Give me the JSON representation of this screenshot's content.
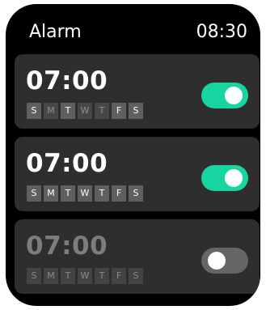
{
  "header": {
    "title": "Alarm",
    "clock": "08:30"
  },
  "alarms": [
    {
      "time": "07:00",
      "enabled": true,
      "days": [
        {
          "label": "S",
          "active": true
        },
        {
          "label": "M",
          "active": false
        },
        {
          "label": "T",
          "active": true
        },
        {
          "label": "W",
          "active": false
        },
        {
          "label": "T",
          "active": false
        },
        {
          "label": "F",
          "active": true
        },
        {
          "label": "S",
          "active": true
        }
      ]
    },
    {
      "time": "07:00",
      "enabled": true,
      "days": [
        {
          "label": "S",
          "active": true
        },
        {
          "label": "M",
          "active": true
        },
        {
          "label": "T",
          "active": true
        },
        {
          "label": "W",
          "active": true
        },
        {
          "label": "T",
          "active": true
        },
        {
          "label": "F",
          "active": true
        },
        {
          "label": "S",
          "active": true
        }
      ]
    },
    {
      "time": "07:00",
      "enabled": false,
      "days": [
        {
          "label": "S",
          "active": true
        },
        {
          "label": "M",
          "active": true
        },
        {
          "label": "T",
          "active": true
        },
        {
          "label": "W",
          "active": true
        },
        {
          "label": "T",
          "active": true
        },
        {
          "label": "F",
          "active": true
        },
        {
          "label": "S",
          "active": true
        }
      ]
    }
  ],
  "colors": {
    "toggle_on": "#17d5a0",
    "toggle_off": "#666666",
    "card": "#2e2e2e",
    "background": "#000000"
  }
}
